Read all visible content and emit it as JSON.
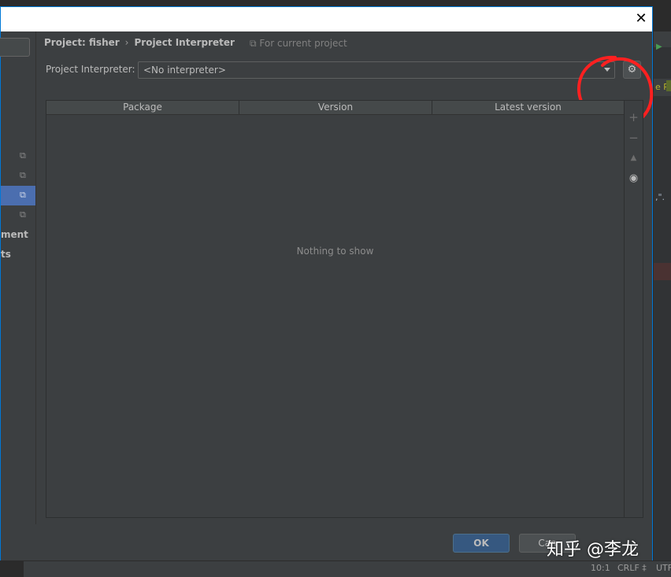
{
  "dialog": {
    "close_glyph": "✕",
    "breadcrumb": {
      "project": "Project: fisher",
      "separator": "›",
      "page": "Project Interpreter"
    },
    "for_current_project": "For current project",
    "interpreter": {
      "label": "Project Interpreter:",
      "value": "<No interpreter>"
    },
    "table": {
      "columns": [
        "Package",
        "Version",
        "Latest version"
      ],
      "empty_text": "Nothing to show"
    },
    "sidebar": {
      "partial_items": [
        "ment",
        "ts"
      ]
    },
    "buttons": {
      "ok": "OK",
      "cancel": "Can"
    }
  },
  "ide_status": {
    "position": "10:1",
    "line_sep": "CRLF ‡",
    "encoding": "UTF"
  },
  "watermark": "知乎 @李龙",
  "colors": {
    "accent": "#4b6eaf",
    "ok_button": "#365880",
    "annotation": "#ff2020",
    "background": "#3c3f41"
  },
  "icons": {
    "gear": "gear-icon",
    "add": "plus-icon",
    "remove": "minus-icon",
    "upgrade": "triangle-up-icon",
    "show": "eye-icon",
    "copy": "copy-icon"
  }
}
